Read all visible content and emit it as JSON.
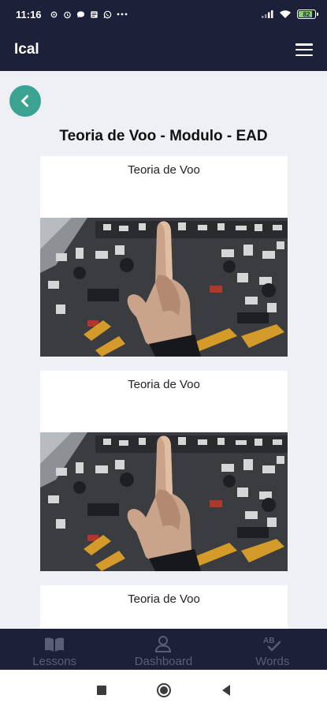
{
  "status_bar": {
    "time": "11:16",
    "battery_level": "82",
    "icons": [
      "settings-icon",
      "alarm-icon",
      "chat-icon",
      "news-icon",
      "whatsapp-icon",
      "more-icon",
      "signal-icon",
      "wifi-icon",
      "battery-icon"
    ]
  },
  "app_bar": {
    "title": "Ical",
    "menu_icon": "hamburger-menu-icon"
  },
  "page": {
    "title": "Teoria de Voo - Modulo - EAD",
    "back_icon": "chevron-left-icon"
  },
  "lessons": [
    {
      "title": "Teoria de Voo",
      "image": "cockpit-photo"
    },
    {
      "title": "Teoria de Voo",
      "image": "cockpit-photo"
    },
    {
      "title": "Teoria de Voo",
      "image": "cockpit-photo"
    }
  ],
  "bottom_nav": {
    "items": [
      {
        "label": "Lessons",
        "icon": "book-icon"
      },
      {
        "label": "Dashboard",
        "icon": "user-icon"
      },
      {
        "label": "Words",
        "icon": "spellcheck-icon"
      }
    ]
  },
  "system_nav": {
    "icons": [
      "recents-icon",
      "home-icon",
      "back-icon"
    ]
  },
  "colors": {
    "primary_dark": "#1c2039",
    "accent": "#3aa392",
    "background": "#eef0f6",
    "nav_inactive": "#5a5f78"
  }
}
